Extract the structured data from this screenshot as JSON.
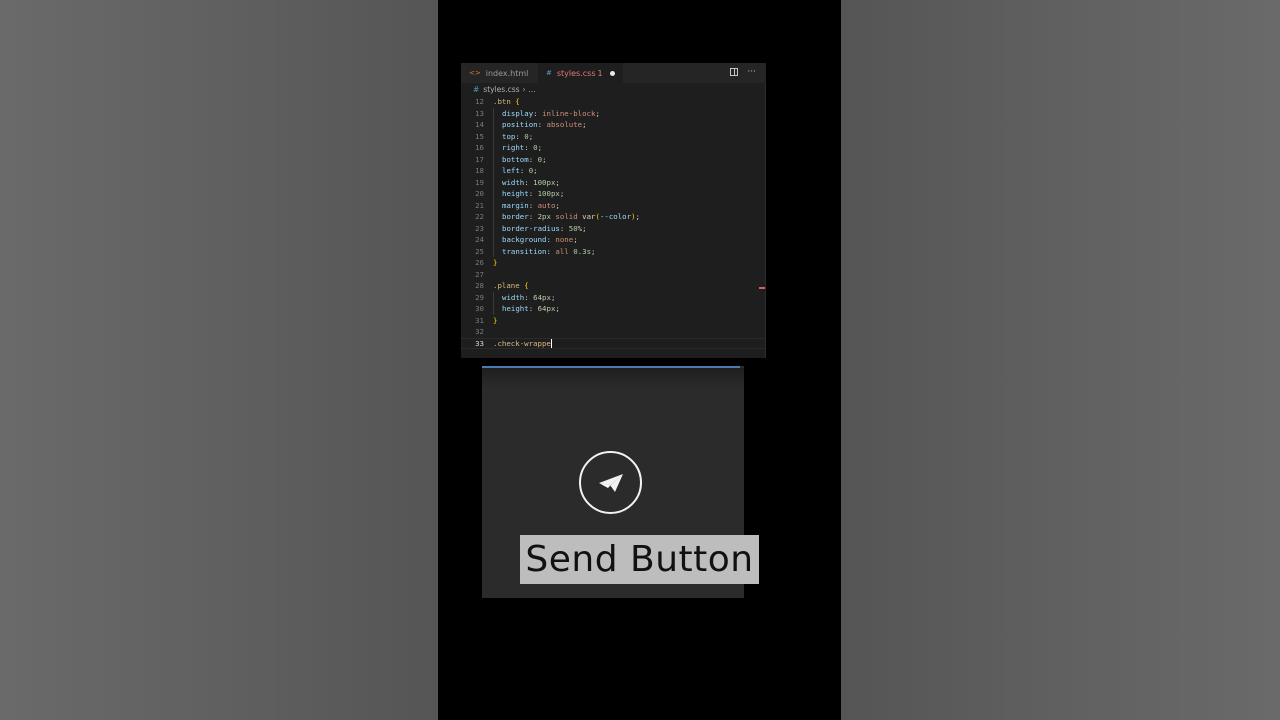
{
  "tabs": [
    {
      "label": "index.html",
      "icon": "html-file-icon"
    },
    {
      "label": "styles.css",
      "icon": "css-file-icon",
      "problems": "1",
      "active": true
    }
  ],
  "breadcrumb": {
    "file": "styles.css",
    "more": "..."
  },
  "code_lines": [
    {
      "n": "12"
    },
    {
      "n": "13"
    },
    {
      "n": "14"
    },
    {
      "n": "15"
    },
    {
      "n": "16"
    },
    {
      "n": "17"
    },
    {
      "n": "18"
    },
    {
      "n": "19"
    },
    {
      "n": "20"
    },
    {
      "n": "21"
    },
    {
      "n": "22"
    },
    {
      "n": "23"
    },
    {
      "n": "24"
    },
    {
      "n": "25"
    },
    {
      "n": "26"
    },
    {
      "n": "27"
    },
    {
      "n": "28"
    },
    {
      "n": "29"
    },
    {
      "n": "30"
    },
    {
      "n": "31"
    },
    {
      "n": "32"
    },
    {
      "n": "33"
    }
  ],
  "code": {
    "btn_selector": ".btn",
    "open": "{",
    "close": "}",
    "display_prop": "display",
    "display_val": "inline-block",
    "position_prop": "position",
    "position_val": "absolute",
    "top_prop": "top",
    "top_val": "0",
    "right_prop": "right",
    "right_val": "0",
    "bottom_prop": "bottom",
    "bottom_val": "0",
    "left_prop": "left",
    "left_val": "0",
    "width_prop": "width",
    "width_val": "100px",
    "height_prop": "height",
    "height_val": "100px",
    "margin_prop": "margin",
    "margin_val": "auto",
    "border_prop": "border",
    "border_num": "2px",
    "border_style": "solid",
    "border_fn": "var",
    "border_var": "--color",
    "radius_prop": "border-radius",
    "radius_val": "50%",
    "bg_prop": "background",
    "bg_val": "none",
    "transition_prop": "transition",
    "transition_all": "all",
    "transition_num": "0.3s",
    "plane_selector": ".plane",
    "pwidth_prop": "width",
    "pwidth_val": "64px",
    "pheight_prop": "height",
    "pheight_val": "64px",
    "typing": ".check-wrappe"
  },
  "caption": "Send Button",
  "colors": {
    "accent": "#4a7bb0",
    "error": "#e07a78"
  }
}
